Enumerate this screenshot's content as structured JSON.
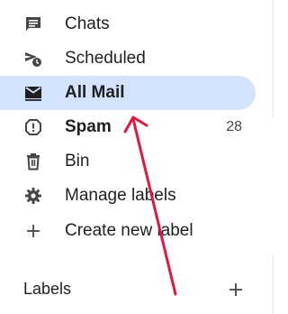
{
  "nav": {
    "items": [
      {
        "label": "Chats",
        "icon": "chat-icon"
      },
      {
        "label": "Scheduled",
        "icon": "scheduled-send-icon"
      },
      {
        "label": "All Mail",
        "icon": "all-mail-icon",
        "active": true
      },
      {
        "label": "Spam",
        "icon": "spam-icon",
        "count": "28"
      },
      {
        "label": "Bin",
        "icon": "trash-icon"
      },
      {
        "label": "Manage labels",
        "icon": "gear-icon"
      },
      {
        "label": "Create new label",
        "icon": "plus-icon"
      }
    ]
  },
  "labels_section": {
    "title": "Labels",
    "add_icon": "plus-icon"
  },
  "colors": {
    "active_bg": "#d3e3fd",
    "annotation_arrow": "#e0183c"
  }
}
